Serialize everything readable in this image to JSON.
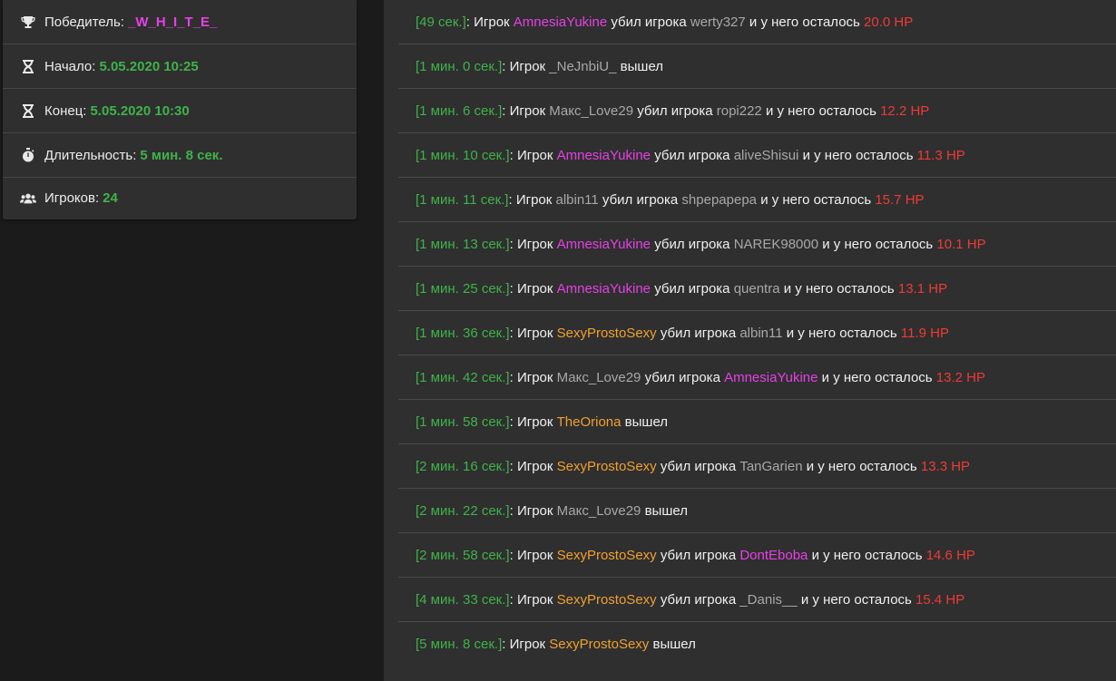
{
  "summary": {
    "winner_label": "Победитель:",
    "winner_value": "_W_H_I_T_E_",
    "start_label": "Начало:",
    "start_value": "5.05.2020 10:25",
    "end_label": "Конец:",
    "end_value": "5.05.2020 10:30",
    "duration_label": "Длительность:",
    "duration_value": "5 мин. 8 сек.",
    "players_label": "Игроков:",
    "players_value": "24"
  },
  "words": {
    "player": "Игрок",
    "killed": "убил игрока",
    "remaining": "и у него осталось",
    "left": "вышел"
  },
  "log": [
    {
      "time": "[49 сек.]",
      "type": "kill",
      "actor": "AmnesiaYukine",
      "actor_color": "pink",
      "victim": "werty327",
      "victim_color": "gray",
      "hp": "20.0 HP"
    },
    {
      "time": "[1 мин. 0 сек.]",
      "type": "leave",
      "actor": "_NeJnbiU_",
      "actor_color": "gray"
    },
    {
      "time": "[1 мин. 6 сек.]",
      "type": "kill",
      "actor": "Макс_Love29",
      "actor_color": "gray",
      "victim": "ropi222",
      "victim_color": "gray",
      "hp": "12.2 HP"
    },
    {
      "time": "[1 мин. 10 сек.]",
      "type": "kill",
      "actor": "AmnesiaYukine",
      "actor_color": "pink",
      "victim": "aliveShisui",
      "victim_color": "gray",
      "hp": "11.3 HP"
    },
    {
      "time": "[1 мин. 11 сек.]",
      "type": "kill",
      "actor": "albin11",
      "actor_color": "gray",
      "victim": "shpepapepa",
      "victim_color": "gray",
      "hp": "15.7 HP"
    },
    {
      "time": "[1 мин. 13 сек.]",
      "type": "kill",
      "actor": "AmnesiaYukine",
      "actor_color": "pink",
      "victim": "NAREK98000",
      "victim_color": "gray",
      "hp": "10.1 HP"
    },
    {
      "time": "[1 мин. 25 сек.]",
      "type": "kill",
      "actor": "AmnesiaYukine",
      "actor_color": "pink",
      "victim": "quentra",
      "victim_color": "gray",
      "hp": "13.1 HP"
    },
    {
      "time": "[1 мин. 36 сек.]",
      "type": "kill",
      "actor": "SexyProstoSexy",
      "actor_color": "orange",
      "victim": "albin11",
      "victim_color": "gray",
      "hp": "11.9 HP"
    },
    {
      "time": "[1 мин. 42 сек.]",
      "type": "kill",
      "actor": "Макс_Love29",
      "actor_color": "gray",
      "victim": "AmnesiaYukine",
      "victim_color": "pink",
      "hp": "13.2 HP"
    },
    {
      "time": "[1 мин. 58 сек.]",
      "type": "leave",
      "actor": "TheOriona",
      "actor_color": "orange"
    },
    {
      "time": "[2 мин. 16 сек.]",
      "type": "kill",
      "actor": "SexyProstoSexy",
      "actor_color": "orange",
      "victim": "TanGarien",
      "victim_color": "gray",
      "hp": "13.3 HP"
    },
    {
      "time": "[2 мин. 22 сек.]",
      "type": "leave",
      "actor": "Макс_Love29",
      "actor_color": "gray"
    },
    {
      "time": "[2 мин. 58 сек.]",
      "type": "kill",
      "actor": "SexyProstoSexy",
      "actor_color": "orange",
      "victim": "DontEboba",
      "victim_color": "pink",
      "hp": "14.6 HP"
    },
    {
      "time": "[4 мин. 33 сек.]",
      "type": "kill",
      "actor": "SexyProstoSexy",
      "actor_color": "orange",
      "victim": "_Danis__",
      "victim_color": "gray",
      "hp": "15.4 HP"
    },
    {
      "time": "[5 мин. 8 сек.]",
      "type": "leave",
      "actor": "SexyProstoSexy",
      "actor_color": "orange"
    }
  ],
  "colors": {
    "accent_green": "#3fb24a",
    "name_pink": "#e640e6",
    "name_orange": "#f0a030",
    "hp_red": "#ee3a35",
    "panel_bg": "#2f2f2f",
    "page_bg": "#1b1b1b"
  },
  "icons": [
    "trophy-icon",
    "hourglass-icon",
    "hourglass-icon",
    "stopwatch-icon",
    "users-icon"
  ]
}
